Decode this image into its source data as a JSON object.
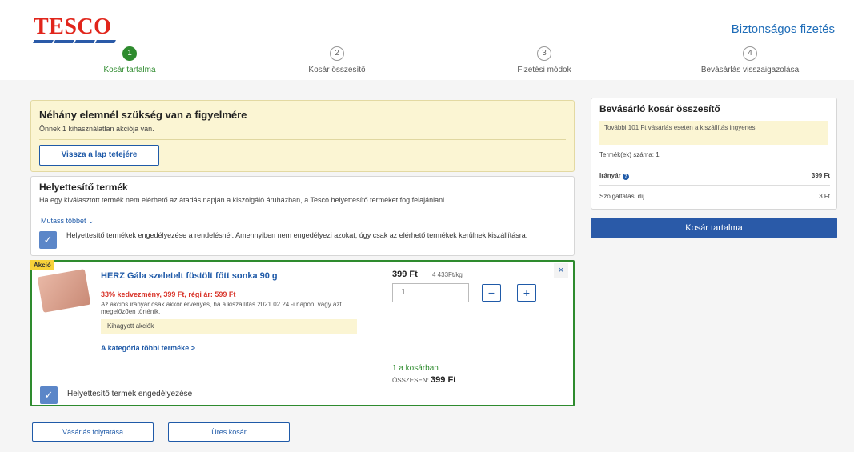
{
  "header": {
    "logo_text": "TESCO",
    "secure_label": "Biztonságos fizetés"
  },
  "steps": [
    {
      "num": "1",
      "label": "Kosár tartalma"
    },
    {
      "num": "2",
      "label": "Kosár összesítő"
    },
    {
      "num": "3",
      "label": "Fizetési módok"
    },
    {
      "num": "4",
      "label": "Bevásárlás visszaigazolása"
    }
  ],
  "attention": {
    "title": "Néhány elemnél szükség van a figyelmére",
    "subtitle": "Önnek 1 kihasználatlan akciója van.",
    "back_button": "Vissza a lap tetejére"
  },
  "substitute": {
    "title": "Helyettesítő termék",
    "description": "Ha egy kiválasztott termék nem elérhető az átadás napján a kiszolgáló áruházban, a Tesco helyettesítő terméket fog felajánlani.",
    "show_more": "Mutass többet",
    "checkbox_text": "Helyettesítő termékek engedélyezése a rendelésnél. Amennyiben nem engedélyezi azokat, úgy csak az elérhető termékek kerülnek kiszállításra."
  },
  "product": {
    "badge": "Akció",
    "name": "HERZ Gála szeletelt füstölt főtt sonka 90 g",
    "discount": "33% kedvezmény, 399 Ft, régi ár: 599 Ft",
    "terms": "Az akciós irányár csak akkor érvényes, ha a kiszállítás 2021.02.24.-i napon, vagy azt megelőzően történik.",
    "missed": "Kihagyott akciók",
    "category_link": "A kategória többi terméke >",
    "price": "399 Ft",
    "unit_price": "4 433Ft/kg",
    "quantity": "1",
    "in_cart": "1 a kosárban",
    "total_label": "ÖSSZESEN:",
    "total_value": "399 Ft",
    "allow_substitute": "Helyettesítő termék engedélyezése",
    "close": "×",
    "minus": "−",
    "plus": "+"
  },
  "summary": {
    "title": "Bevásárló kosár összesítő",
    "note": "További 101 Ft vásárlás esetén a kiszállítás ingyenes.",
    "items_count_label": "Termék(ek) száma: 1",
    "guide_price_label": "Irányár",
    "guide_price_value": "399 Ft",
    "service_fee_label": "Szolgáltatási díj",
    "service_fee_value": "3 Ft"
  },
  "cart_button": "Kosár tartalma",
  "footer": {
    "continue_shopping": "Vásárlás folytatása",
    "empty_cart": "Üres kosár"
  },
  "colors": {
    "brand_red": "#e1251b",
    "brand_blue": "#2a5aa8",
    "green": "#2e8b2e",
    "warn_bg": "#fbf5d3"
  }
}
